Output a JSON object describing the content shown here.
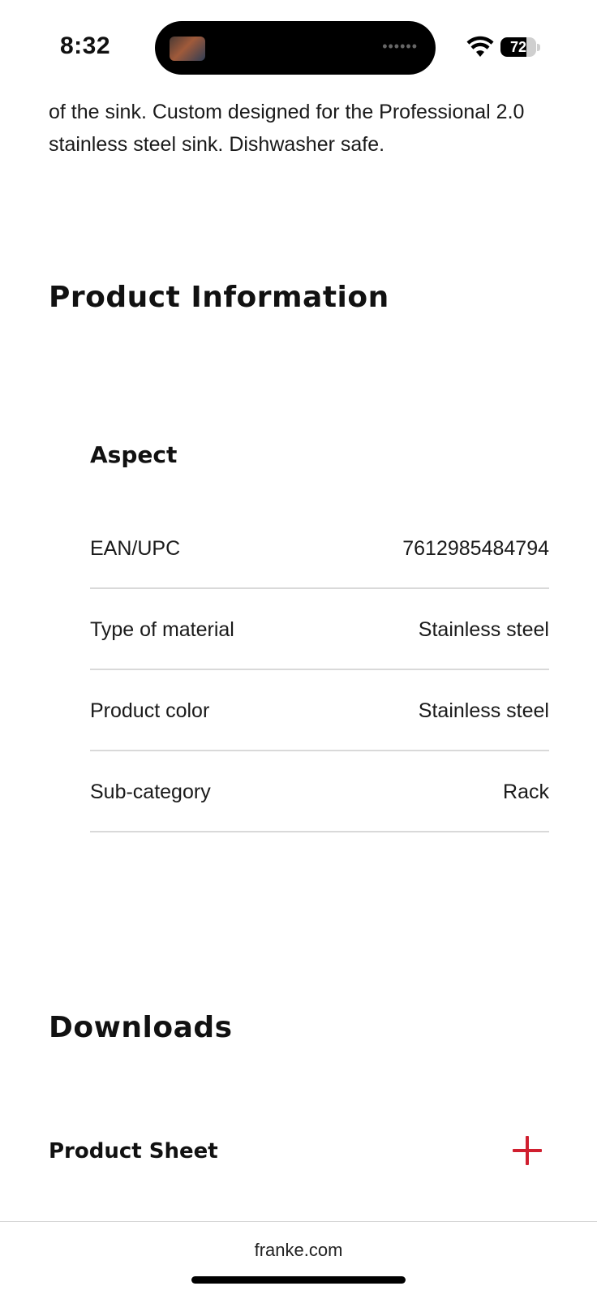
{
  "status_bar": {
    "time": "8:32",
    "battery_level": "72",
    "battery_fraction": 0.72,
    "island_dots": "••••••"
  },
  "content": {
    "description": "of the sink. Custom designed for the Professional 2.0 stainless steel sink. Dishwasher safe."
  },
  "product_information": {
    "heading": "Product Information",
    "group_title": "Aspect",
    "rows": [
      {
        "label": "EAN/UPC",
        "value": "7612985484794"
      },
      {
        "label": "Type of material",
        "value": "Stainless steel"
      },
      {
        "label": "Product color",
        "value": "Stainless steel"
      },
      {
        "label": "Sub-category",
        "value": "Rack"
      }
    ]
  },
  "downloads": {
    "heading": "Downloads",
    "items": [
      {
        "label": "Product Sheet",
        "icon": "plus-icon"
      }
    ]
  },
  "browser": {
    "url": "franke.com"
  },
  "colors": {
    "accent": "#d01f2f",
    "divider": "#d9d9d9",
    "text": "#111111"
  }
}
